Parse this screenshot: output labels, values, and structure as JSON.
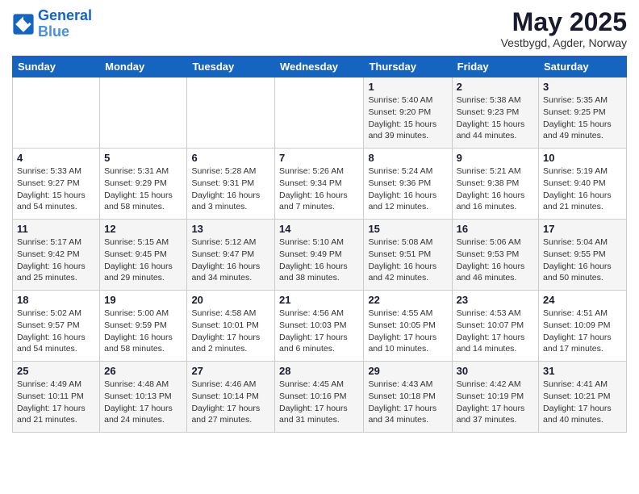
{
  "header": {
    "logo_line1": "General",
    "logo_line2": "Blue",
    "month": "May 2025",
    "location": "Vestbygd, Agder, Norway"
  },
  "weekdays": [
    "Sunday",
    "Monday",
    "Tuesday",
    "Wednesday",
    "Thursday",
    "Friday",
    "Saturday"
  ],
  "weeks": [
    [
      {
        "day": "",
        "detail": ""
      },
      {
        "day": "",
        "detail": ""
      },
      {
        "day": "",
        "detail": ""
      },
      {
        "day": "",
        "detail": ""
      },
      {
        "day": "1",
        "detail": "Sunrise: 5:40 AM\nSunset: 9:20 PM\nDaylight: 15 hours\nand 39 minutes."
      },
      {
        "day": "2",
        "detail": "Sunrise: 5:38 AM\nSunset: 9:23 PM\nDaylight: 15 hours\nand 44 minutes."
      },
      {
        "day": "3",
        "detail": "Sunrise: 5:35 AM\nSunset: 9:25 PM\nDaylight: 15 hours\nand 49 minutes."
      }
    ],
    [
      {
        "day": "4",
        "detail": "Sunrise: 5:33 AM\nSunset: 9:27 PM\nDaylight: 15 hours\nand 54 minutes."
      },
      {
        "day": "5",
        "detail": "Sunrise: 5:31 AM\nSunset: 9:29 PM\nDaylight: 15 hours\nand 58 minutes."
      },
      {
        "day": "6",
        "detail": "Sunrise: 5:28 AM\nSunset: 9:31 PM\nDaylight: 16 hours\nand 3 minutes."
      },
      {
        "day": "7",
        "detail": "Sunrise: 5:26 AM\nSunset: 9:34 PM\nDaylight: 16 hours\nand 7 minutes."
      },
      {
        "day": "8",
        "detail": "Sunrise: 5:24 AM\nSunset: 9:36 PM\nDaylight: 16 hours\nand 12 minutes."
      },
      {
        "day": "9",
        "detail": "Sunrise: 5:21 AM\nSunset: 9:38 PM\nDaylight: 16 hours\nand 16 minutes."
      },
      {
        "day": "10",
        "detail": "Sunrise: 5:19 AM\nSunset: 9:40 PM\nDaylight: 16 hours\nand 21 minutes."
      }
    ],
    [
      {
        "day": "11",
        "detail": "Sunrise: 5:17 AM\nSunset: 9:42 PM\nDaylight: 16 hours\nand 25 minutes."
      },
      {
        "day": "12",
        "detail": "Sunrise: 5:15 AM\nSunset: 9:45 PM\nDaylight: 16 hours\nand 29 minutes."
      },
      {
        "day": "13",
        "detail": "Sunrise: 5:12 AM\nSunset: 9:47 PM\nDaylight: 16 hours\nand 34 minutes."
      },
      {
        "day": "14",
        "detail": "Sunrise: 5:10 AM\nSunset: 9:49 PM\nDaylight: 16 hours\nand 38 minutes."
      },
      {
        "day": "15",
        "detail": "Sunrise: 5:08 AM\nSunset: 9:51 PM\nDaylight: 16 hours\nand 42 minutes."
      },
      {
        "day": "16",
        "detail": "Sunrise: 5:06 AM\nSunset: 9:53 PM\nDaylight: 16 hours\nand 46 minutes."
      },
      {
        "day": "17",
        "detail": "Sunrise: 5:04 AM\nSunset: 9:55 PM\nDaylight: 16 hours\nand 50 minutes."
      }
    ],
    [
      {
        "day": "18",
        "detail": "Sunrise: 5:02 AM\nSunset: 9:57 PM\nDaylight: 16 hours\nand 54 minutes."
      },
      {
        "day": "19",
        "detail": "Sunrise: 5:00 AM\nSunset: 9:59 PM\nDaylight: 16 hours\nand 58 minutes."
      },
      {
        "day": "20",
        "detail": "Sunrise: 4:58 AM\nSunset: 10:01 PM\nDaylight: 17 hours\nand 2 minutes."
      },
      {
        "day": "21",
        "detail": "Sunrise: 4:56 AM\nSunset: 10:03 PM\nDaylight: 17 hours\nand 6 minutes."
      },
      {
        "day": "22",
        "detail": "Sunrise: 4:55 AM\nSunset: 10:05 PM\nDaylight: 17 hours\nand 10 minutes."
      },
      {
        "day": "23",
        "detail": "Sunrise: 4:53 AM\nSunset: 10:07 PM\nDaylight: 17 hours\nand 14 minutes."
      },
      {
        "day": "24",
        "detail": "Sunrise: 4:51 AM\nSunset: 10:09 PM\nDaylight: 17 hours\nand 17 minutes."
      }
    ],
    [
      {
        "day": "25",
        "detail": "Sunrise: 4:49 AM\nSunset: 10:11 PM\nDaylight: 17 hours\nand 21 minutes."
      },
      {
        "day": "26",
        "detail": "Sunrise: 4:48 AM\nSunset: 10:13 PM\nDaylight: 17 hours\nand 24 minutes."
      },
      {
        "day": "27",
        "detail": "Sunrise: 4:46 AM\nSunset: 10:14 PM\nDaylight: 17 hours\nand 27 minutes."
      },
      {
        "day": "28",
        "detail": "Sunrise: 4:45 AM\nSunset: 10:16 PM\nDaylight: 17 hours\nand 31 minutes."
      },
      {
        "day": "29",
        "detail": "Sunrise: 4:43 AM\nSunset: 10:18 PM\nDaylight: 17 hours\nand 34 minutes."
      },
      {
        "day": "30",
        "detail": "Sunrise: 4:42 AM\nSunset: 10:19 PM\nDaylight: 17 hours\nand 37 minutes."
      },
      {
        "day": "31",
        "detail": "Sunrise: 4:41 AM\nSunset: 10:21 PM\nDaylight: 17 hours\nand 40 minutes."
      }
    ]
  ]
}
